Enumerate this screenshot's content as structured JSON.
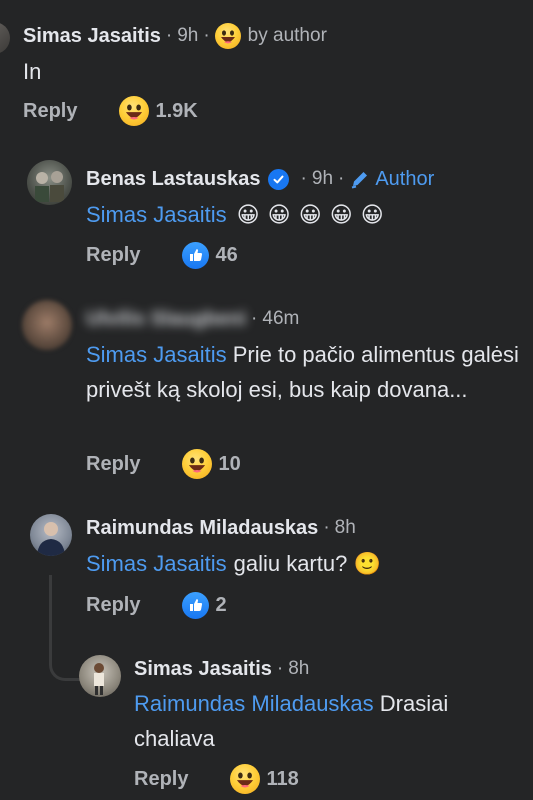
{
  "comments": [
    {
      "name": "Simas Jasaitis",
      "time": "9h",
      "badge": "by author",
      "text": "In",
      "reply_label": "Reply",
      "reaction": "laugh",
      "reaction_count": "1.9K"
    },
    {
      "name": "Benas Lastauskas",
      "verified": true,
      "time": "9h",
      "badge": "Author",
      "mention": "Simas Jasaitis",
      "text_emojis": "😀 😀 😀 😀 😀",
      "reply_label": "Reply",
      "reaction": "like",
      "reaction_count": "46"
    },
    {
      "name": "Ulvilis Slaugbeni",
      "blurred": true,
      "time": "46m",
      "mention": "Simas Jasaitis",
      "text": "Prie to pačio alimentus galėsi privešt ką skoloj esi, bus kaip dovana...",
      "reply_label": "Reply",
      "reaction": "laugh",
      "reaction_count": "10"
    },
    {
      "name": "Raimundas Miladauskas",
      "time": "8h",
      "mention": "Simas Jasaitis",
      "text": "galiu kartu? 🙂",
      "reply_label": "Reply",
      "reaction": "like",
      "reaction_count": "2"
    },
    {
      "name": "Simas Jasaitis",
      "time": "8h",
      "mention": "Raimundas Miladauskas",
      "text": "Drasiai chaliava",
      "reply_label": "Reply",
      "reaction": "laugh",
      "reaction_count": "118"
    }
  ],
  "separator": "·",
  "colors": {
    "background": "#242526",
    "mention": "#4e9bf0",
    "secondary_text": "#b0b3b8",
    "like_blue": "#1877f2"
  },
  "icons": [
    "laugh-emoji-icon",
    "thumbs-up-icon",
    "verified-badge-icon",
    "pencil-icon",
    "slight-smile-emoji-icon"
  ]
}
